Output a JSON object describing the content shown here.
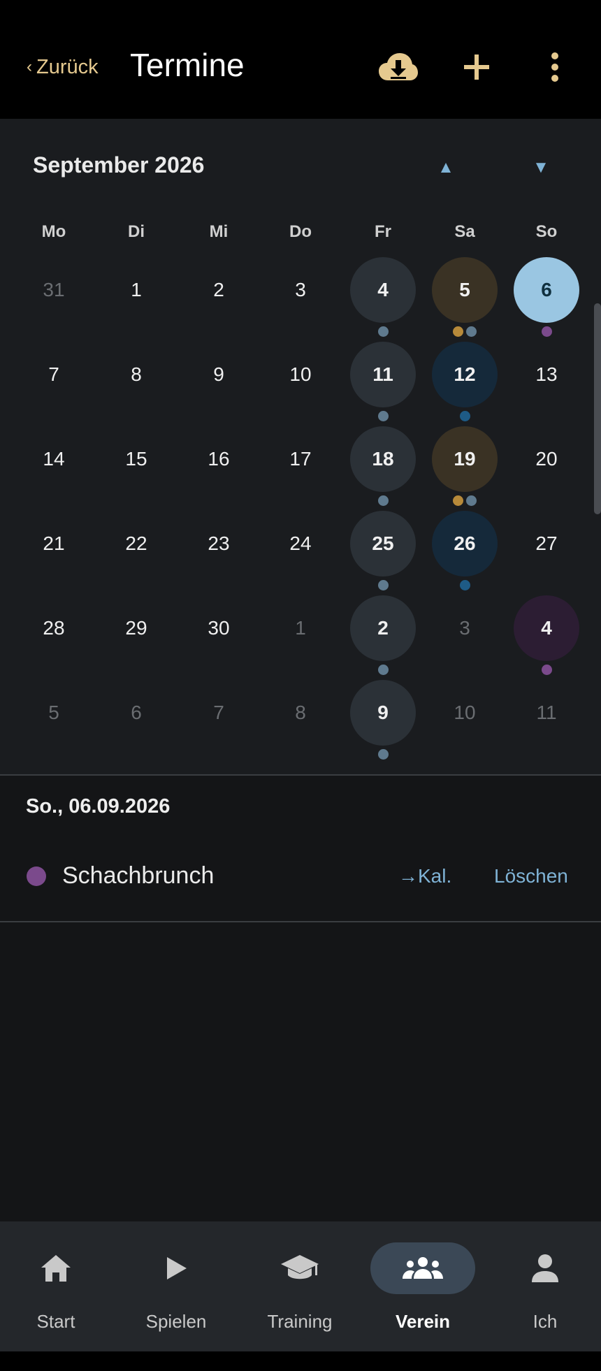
{
  "header": {
    "back_label": "Zurück",
    "back_chevron": "‹",
    "title": "Termine",
    "icons": [
      "cloud-download-icon",
      "plus-icon",
      "more-vertical-icon"
    ]
  },
  "calendar": {
    "month_label": "September 2026",
    "prev_arrow": "▲",
    "next_arrow": "▼",
    "weekdays": [
      "Mo",
      "Di",
      "Mi",
      "Do",
      "Fr",
      "Sa",
      "So"
    ],
    "colors": {
      "training_bg": "#2b3137",
      "tournament_bg": "#3a3224",
      "league_bg": "#15293a",
      "social_bg": "#2c1d33",
      "selected_bg": "#9ac6e2",
      "dot_training": "#5f7a8e",
      "dot_tournament": "#b78a3a",
      "dot_league": "#1e5b86",
      "dot_social": "#7b4a8c"
    },
    "weeks": [
      [
        {
          "label": "31",
          "muted": true
        },
        {
          "label": "1"
        },
        {
          "label": "2"
        },
        {
          "label": "3"
        },
        {
          "label": "4",
          "bg": "training_bg",
          "dots": [
            "dot_training"
          ]
        },
        {
          "label": "5",
          "bg": "tournament_bg",
          "dots": [
            "dot_tournament",
            "dot_training"
          ]
        },
        {
          "label": "6",
          "bg": "selected_bg",
          "selected": true,
          "dots": [
            "dot_social"
          ]
        }
      ],
      [
        {
          "label": "7"
        },
        {
          "label": "8"
        },
        {
          "label": "9"
        },
        {
          "label": "10"
        },
        {
          "label": "11",
          "bg": "training_bg",
          "dots": [
            "dot_training"
          ]
        },
        {
          "label": "12",
          "bg": "league_bg",
          "dots": [
            "dot_league"
          ]
        },
        {
          "label": "13"
        }
      ],
      [
        {
          "label": "14"
        },
        {
          "label": "15"
        },
        {
          "label": "16"
        },
        {
          "label": "17"
        },
        {
          "label": "18",
          "bg": "training_bg",
          "dots": [
            "dot_training"
          ]
        },
        {
          "label": "19",
          "bg": "tournament_bg",
          "dots": [
            "dot_tournament",
            "dot_training"
          ]
        },
        {
          "label": "20"
        }
      ],
      [
        {
          "label": "21"
        },
        {
          "label": "22"
        },
        {
          "label": "23"
        },
        {
          "label": "24"
        },
        {
          "label": "25",
          "bg": "training_bg",
          "dots": [
            "dot_training"
          ]
        },
        {
          "label": "26",
          "bg": "league_bg",
          "dots": [
            "dot_league"
          ]
        },
        {
          "label": "27"
        }
      ],
      [
        {
          "label": "28"
        },
        {
          "label": "29"
        },
        {
          "label": "30"
        },
        {
          "label": "1",
          "muted": true
        },
        {
          "label": "2",
          "bg": "training_bg",
          "dots": [
            "dot_training"
          ]
        },
        {
          "label": "3",
          "muted": true
        },
        {
          "label": "4",
          "bg": "social_bg",
          "dots": [
            "dot_social"
          ]
        }
      ],
      [
        {
          "label": "5",
          "muted": true
        },
        {
          "label": "6",
          "muted": true
        },
        {
          "label": "7",
          "muted": true
        },
        {
          "label": "8",
          "muted": true
        },
        {
          "label": "9",
          "bg": "training_bg",
          "dots": [
            "dot_training"
          ]
        },
        {
          "label": "10",
          "muted": true
        },
        {
          "label": "11",
          "muted": true
        }
      ]
    ]
  },
  "selected_day": {
    "date_label": "So., 06.09.2026",
    "events": [
      {
        "name": "Schachbrunch",
        "color": "#7b4a8c",
        "calendar_link": "→Kal.",
        "delete_label": "Löschen"
      }
    ]
  },
  "bottom_nav": {
    "items": [
      {
        "label": "Start",
        "icon": "home-icon"
      },
      {
        "label": "Spielen",
        "icon": "play-icon"
      },
      {
        "label": "Training",
        "icon": "graduation-cap-icon"
      },
      {
        "label": "Verein",
        "icon": "group-icon",
        "active": true
      },
      {
        "label": "Ich",
        "icon": "person-icon"
      }
    ]
  }
}
